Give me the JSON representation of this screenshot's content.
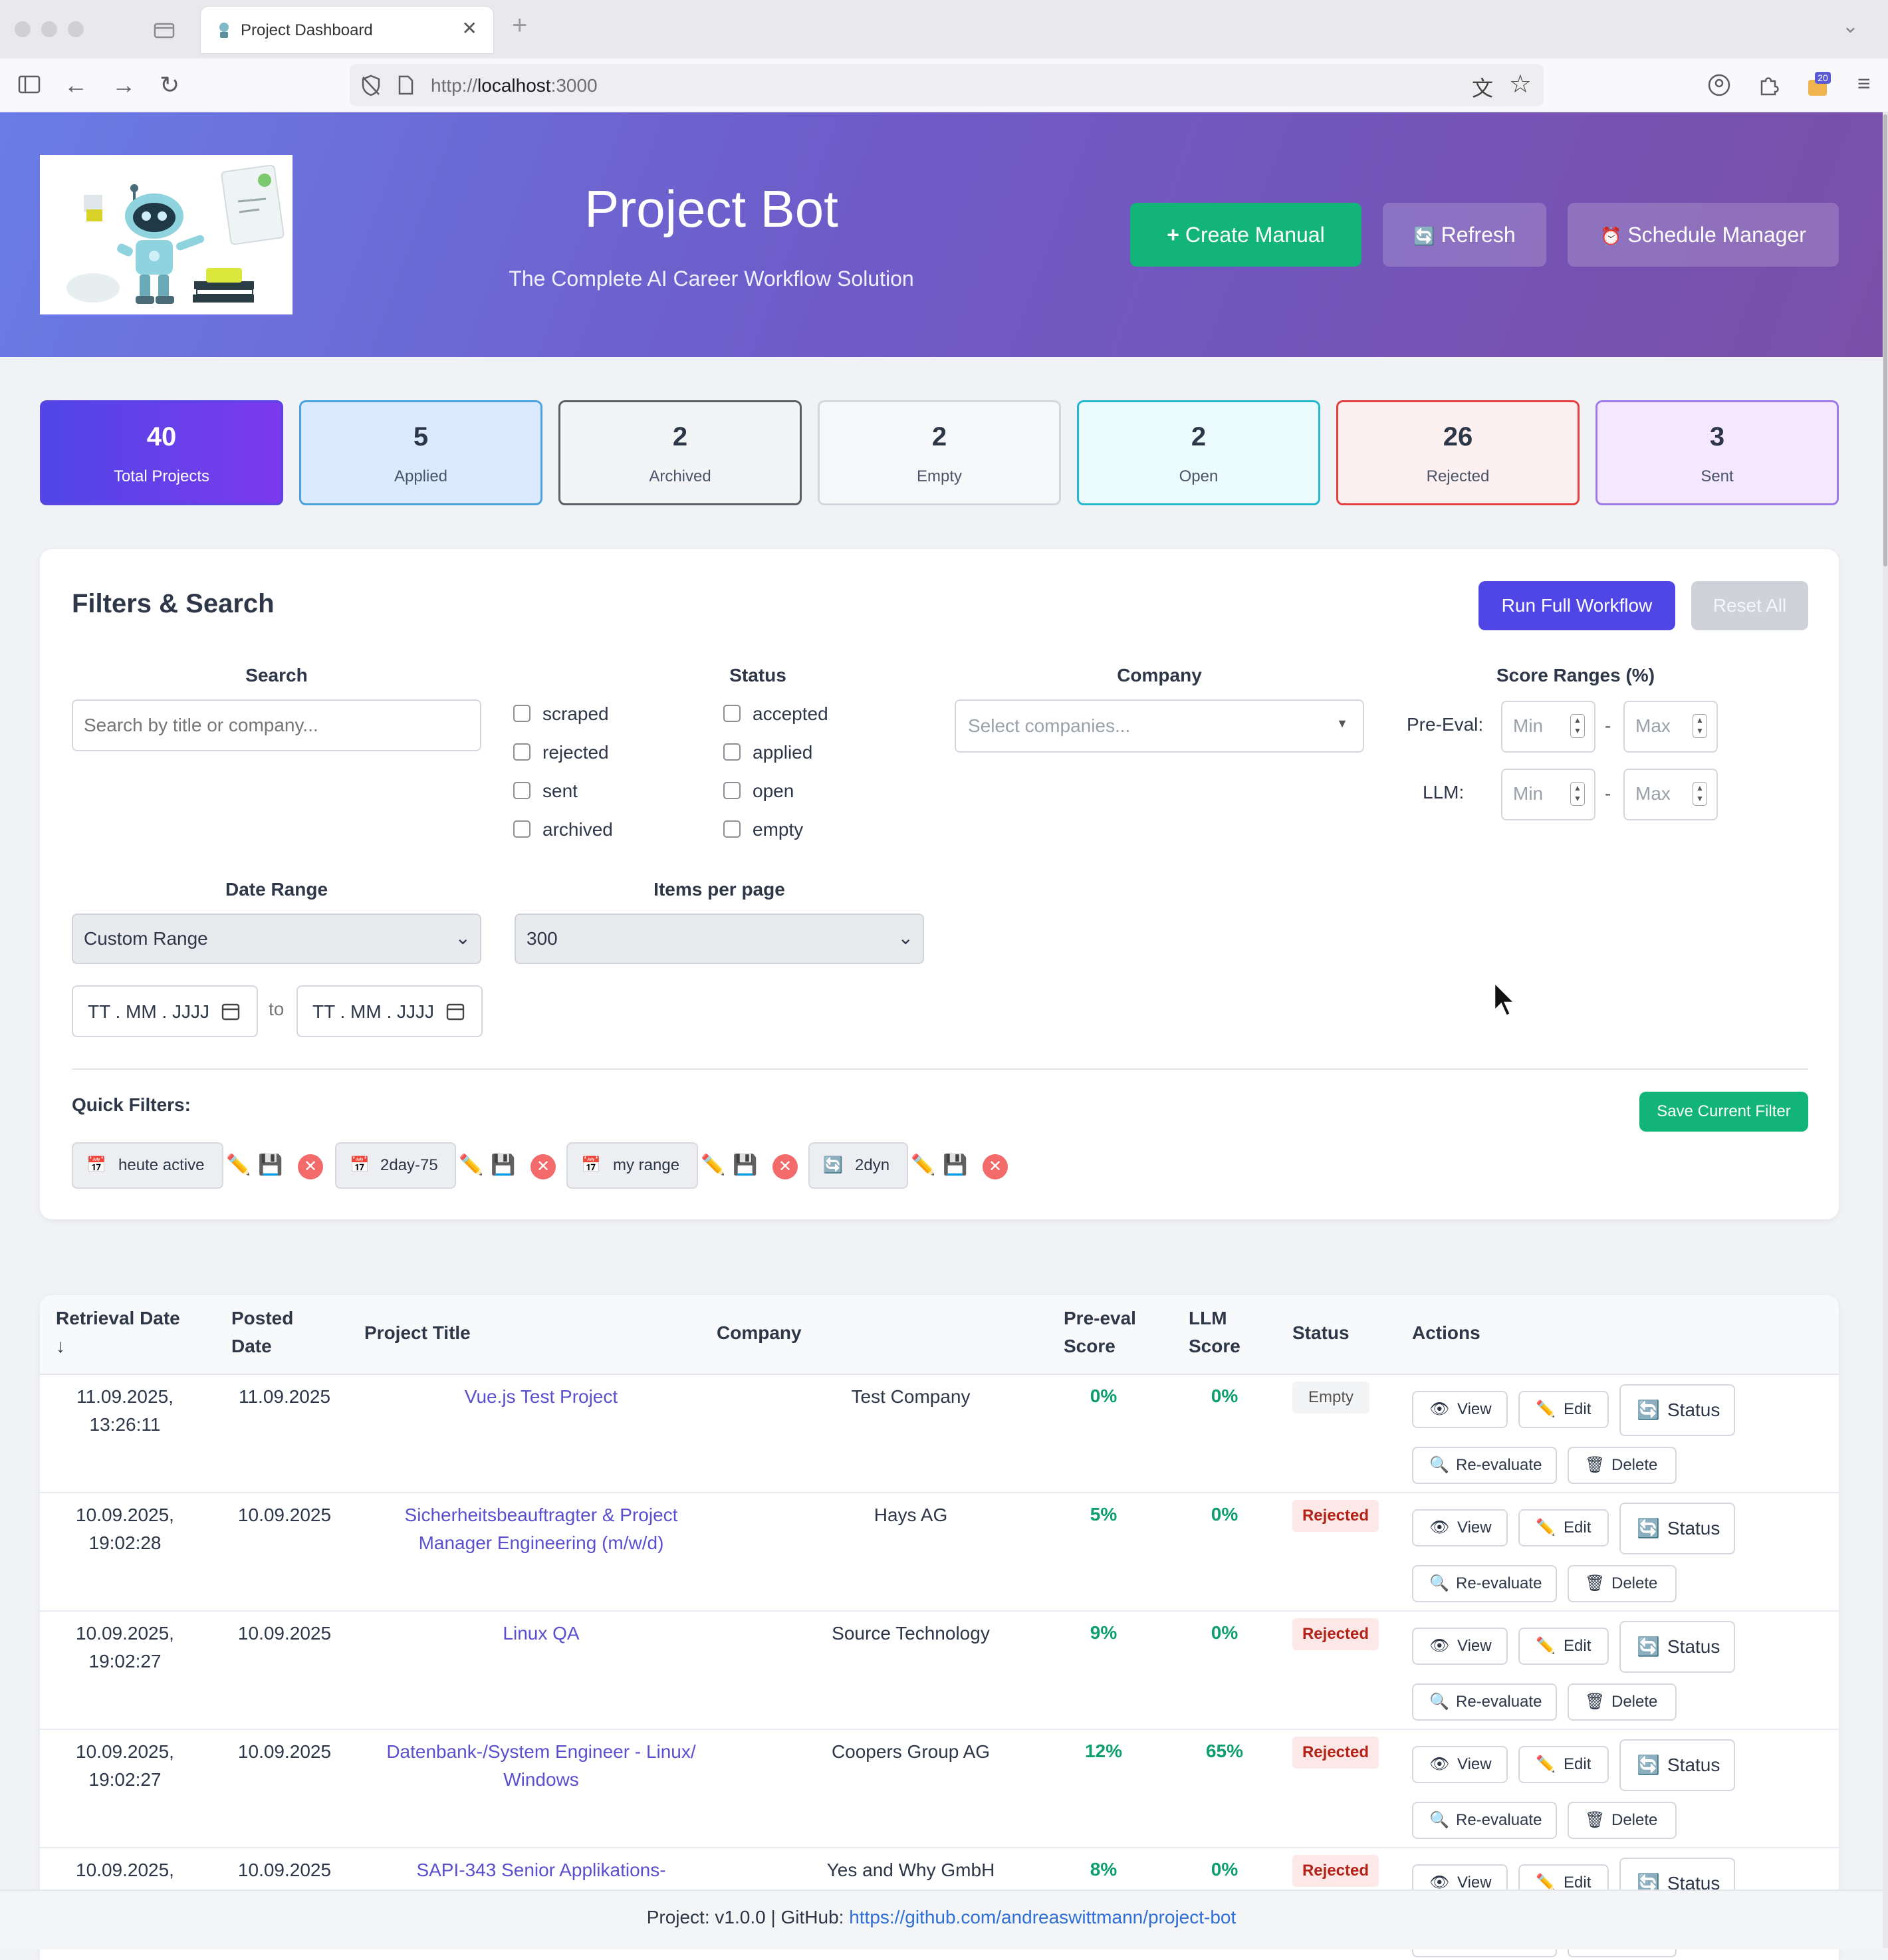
{
  "browser": {
    "tab_title": "Project Dashboard",
    "tab_close": "✕",
    "new_tab": "+",
    "url_prefix": "http://",
    "url_host": "localhost",
    "url_suffix": ":3000",
    "extension_badge": "20"
  },
  "header": {
    "title": "Project Bot",
    "subtitle": "The Complete AI Career Workflow Solution",
    "create_button": "Create Manual",
    "create_icon": "+",
    "refresh_button": "Refresh",
    "refresh_icon": "🔄",
    "schedule_button": "Schedule Manager",
    "schedule_icon": "⏰"
  },
  "stats": [
    {
      "value": "40",
      "label": "Total Projects",
      "color": "#4f46e5"
    },
    {
      "value": "5",
      "label": "Applied",
      "color": "#4aa3df"
    },
    {
      "value": "2",
      "label": "Archived",
      "color": "#5a5f66"
    },
    {
      "value": "2",
      "label": "Empty",
      "color": "#d4d7dd"
    },
    {
      "value": "2",
      "label": "Open",
      "color": "#22b8cf"
    },
    {
      "value": "26",
      "label": "Rejected",
      "color": "#e53e3e"
    },
    {
      "value": "3",
      "label": "Sent",
      "color": "#9f7aea"
    }
  ],
  "filters": {
    "title": "Filters & Search",
    "run_workflow": "Run Full Workflow",
    "reset_all": "Reset All",
    "search_label": "Search",
    "search_placeholder": "Search by title or company...",
    "status_label": "Status",
    "statuses": [
      "scraped",
      "rejected",
      "sent",
      "archived",
      "accepted",
      "applied",
      "open",
      "empty"
    ],
    "company_label": "Company",
    "company_placeholder": "Select companies...",
    "score_label": "Score Ranges (%)",
    "pre_eval_label": "Pre-Eval:",
    "llm_label": "LLM:",
    "min_placeholder": "Min",
    "max_placeholder": "Max",
    "range_dash": "-",
    "date_range_label": "Date Range",
    "date_range_value": "Custom Range",
    "items_label": "Items per page",
    "items_value": "300",
    "date_placeholder": "TT . MM . JJJJ",
    "date_to": "to",
    "quick_filters_label": "Quick Filters:",
    "save_filter": "Save Current Filter",
    "quick_filters": [
      {
        "icon": "📅",
        "label": "heute active"
      },
      {
        "icon": "📅",
        "label": "2day-75"
      },
      {
        "icon": "📅",
        "label": "my range"
      },
      {
        "icon": "🔄",
        "label": "2dyn"
      }
    ]
  },
  "table": {
    "headers": {
      "retrieval": "Retrieval Date",
      "sort_arrow": "↓",
      "posted_1": "Posted",
      "posted_2": "Date",
      "title": "Project Title",
      "company": "Company",
      "pre_1": "Pre-eval",
      "pre_2": "Score",
      "llm_1": "LLM",
      "llm_2": "Score",
      "status": "Status",
      "actions": "Actions"
    },
    "actions": {
      "view": "View",
      "edit": "Edit",
      "status": "Status",
      "reevaluate": "Re-evaluate",
      "delete": "Delete"
    },
    "rows": [
      {
        "retrieval_1": "11.09.2025,",
        "retrieval_2": "13:26:11",
        "posted": "11.09.2025",
        "title_1": "Vue.js Test Project",
        "title_2": "",
        "company": "Test Company",
        "pre": "0%",
        "llm": "0%",
        "status": "Empty"
      },
      {
        "retrieval_1": "10.09.2025,",
        "retrieval_2": "19:02:28",
        "posted": "10.09.2025",
        "title_1": "Sicherheitsbeauftragter & Project",
        "title_2": "Manager Engineering (m/w/d)",
        "company": "Hays AG",
        "pre": "5%",
        "llm": "0%",
        "status": "Rejected"
      },
      {
        "retrieval_1": "10.09.2025,",
        "retrieval_2": "19:02:27",
        "posted": "10.09.2025",
        "title_1": "Linux QA",
        "title_2": "",
        "company": "Source Technology",
        "pre": "9%",
        "llm": "0%",
        "status": "Rejected"
      },
      {
        "retrieval_1": "10.09.2025,",
        "retrieval_2": "19:02:27",
        "posted": "10.09.2025",
        "title_1": "Datenbank-/System Engineer - Linux/",
        "title_2": "Windows",
        "company": "Coopers Group AG",
        "pre": "12%",
        "llm": "65%",
        "status": "Rejected"
      },
      {
        "retrieval_1": "10.09.2025,",
        "retrieval_2": "",
        "posted": "10.09.2025",
        "title_1": "SAPI-343 Senior Applikations-",
        "title_2": "",
        "company": "Yes and Why GmbH",
        "pre": "8%",
        "llm": "0%",
        "status": "Rejected"
      }
    ]
  },
  "footer": {
    "text": "Project: v1.0.0 | GitHub: ",
    "link": "https://github.com/andreaswittmann/project-bot"
  }
}
